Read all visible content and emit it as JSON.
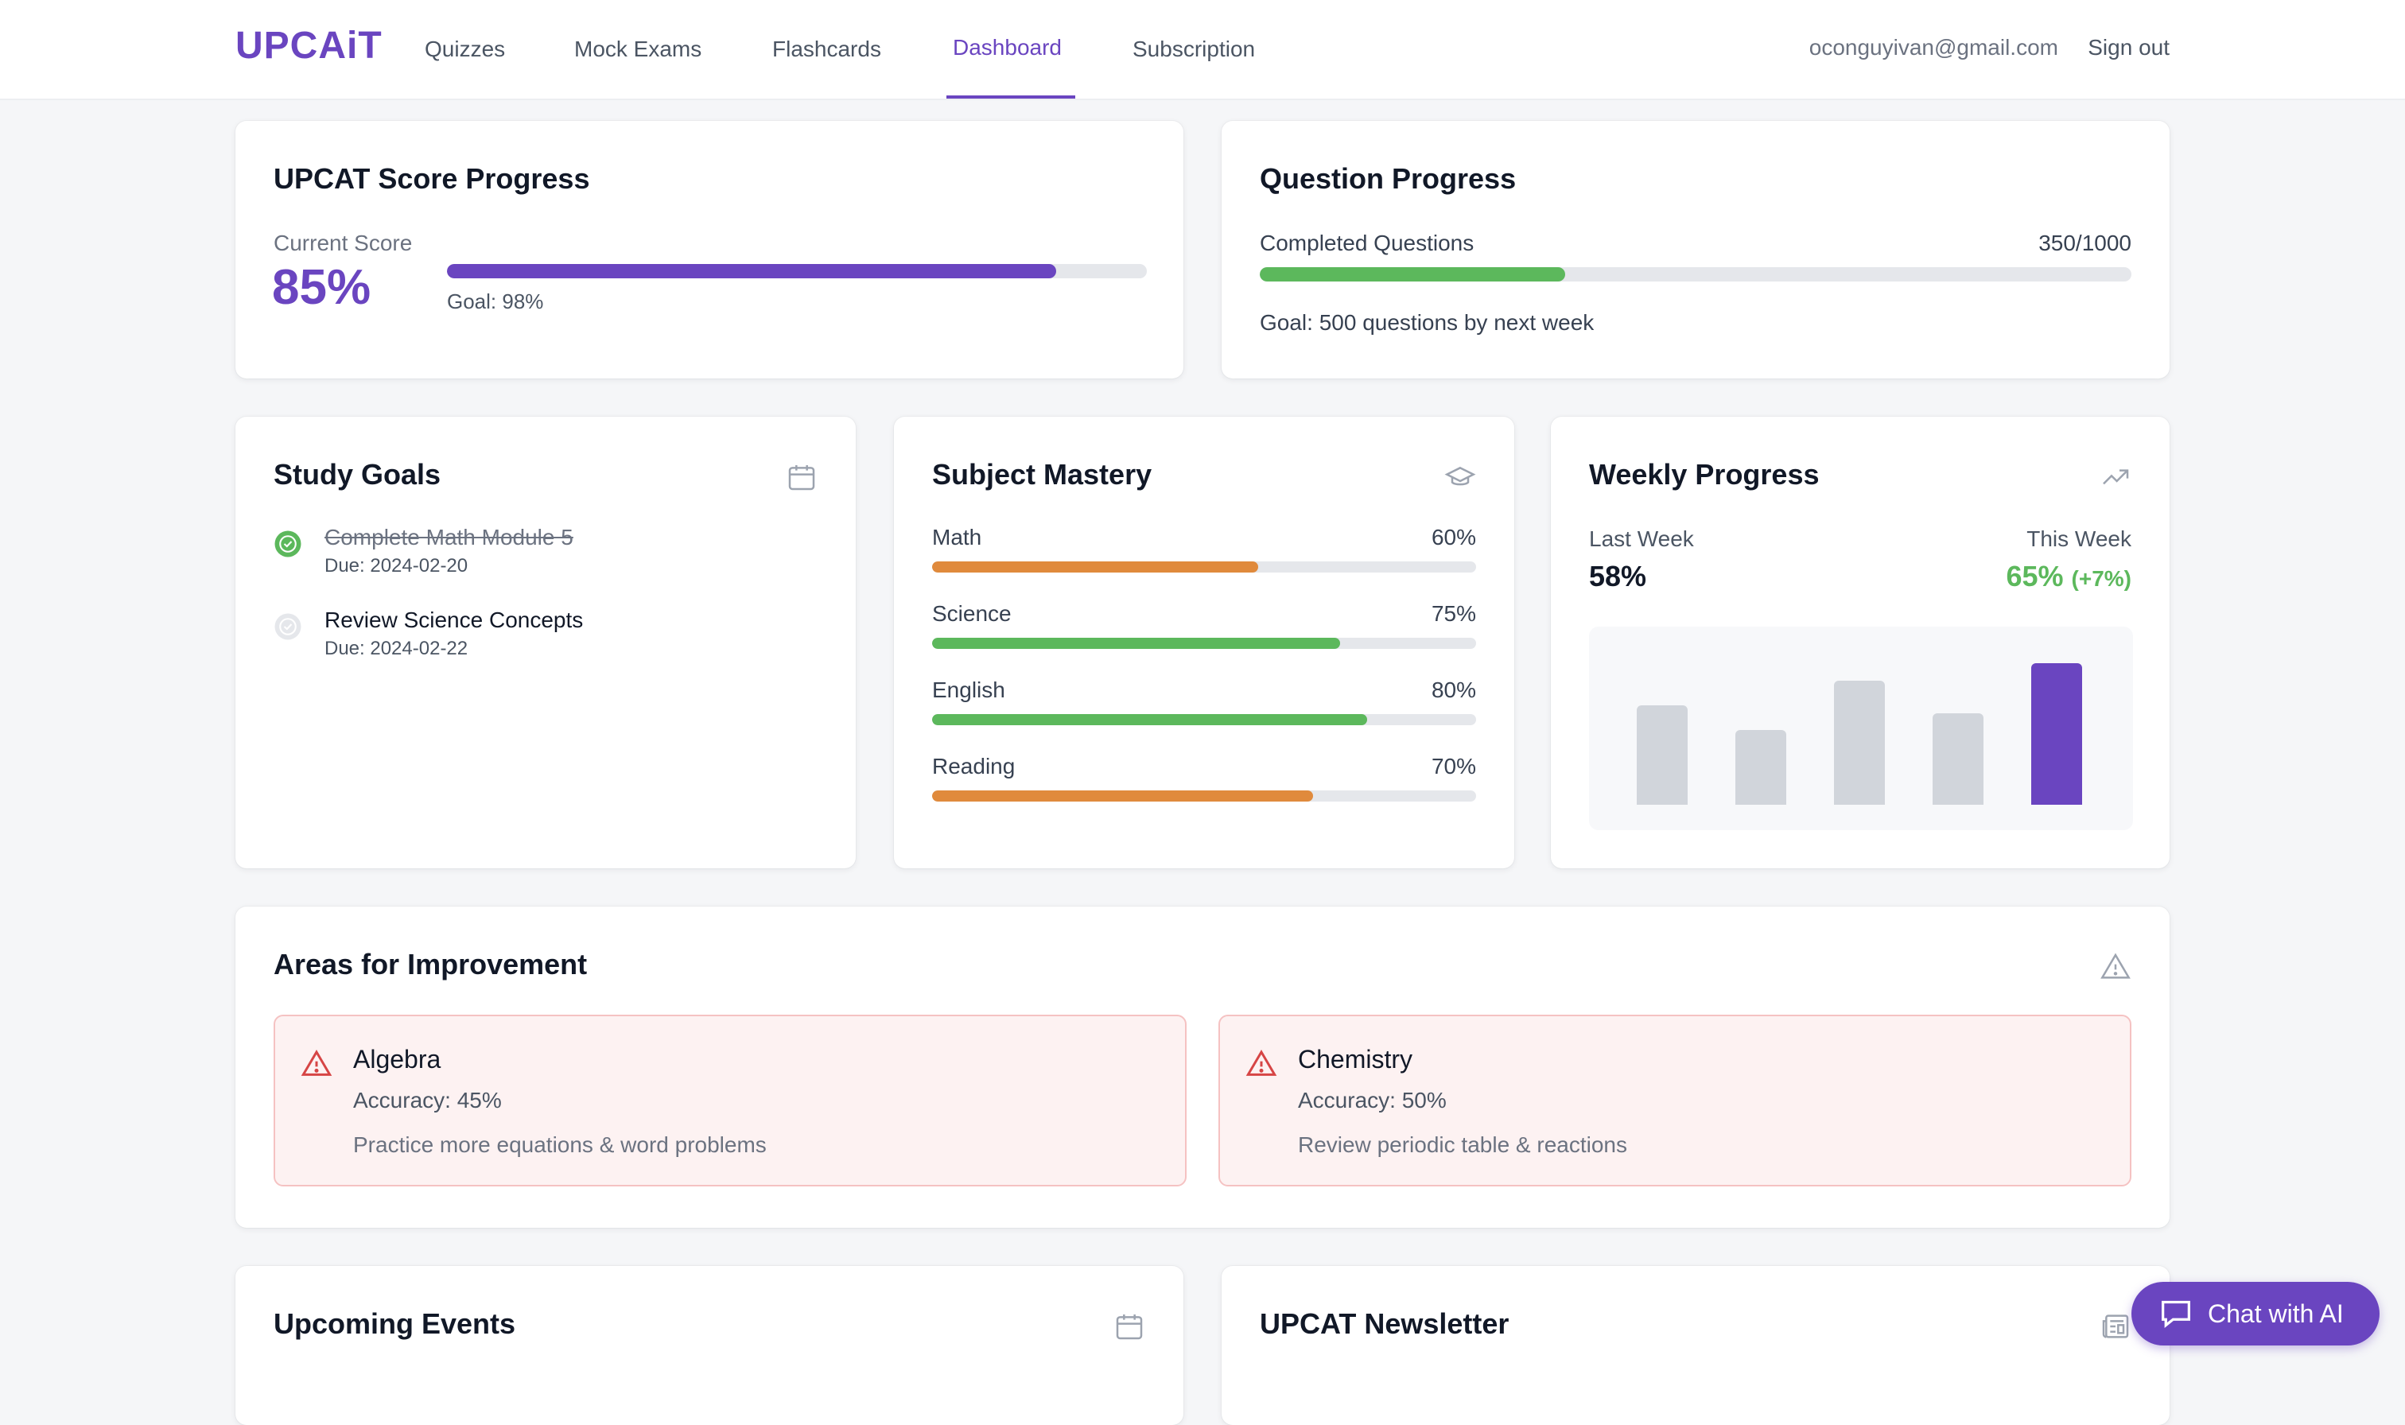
{
  "nav": {
    "brand": "UPCAiT",
    "links": [
      "Quizzes",
      "Mock Exams",
      "Flashcards",
      "Dashboard",
      "Subscription"
    ],
    "active": "Dashboard",
    "email": "oconguyivan@gmail.com",
    "sign_out": "Sign out"
  },
  "score_progress": {
    "title": "UPCAT Score Progress",
    "current_label": "Current Score",
    "current_value": "85%",
    "progress_fraction": 0.87,
    "goal": "Goal: 98%"
  },
  "question_progress": {
    "title": "Question Progress",
    "label": "Completed Questions",
    "count": "350/1000",
    "progress_fraction": 0.35,
    "goal": "Goal: 500 questions by next week"
  },
  "study_goals": {
    "title": "Study Goals",
    "icon": "calendar-icon",
    "items": [
      {
        "text": "Complete Math Module 5",
        "due": "Due: 2024-02-20",
        "done": true
      },
      {
        "text": "Review Science Concepts",
        "due": "Due: 2024-02-22",
        "done": false
      }
    ]
  },
  "subject_mastery": {
    "title": "Subject Mastery",
    "icon": "graduation-cap-icon",
    "subjects": [
      {
        "name": "Math",
        "percent": "60%",
        "value": 60,
        "color": "#e08a3c"
      },
      {
        "name": "Science",
        "percent": "75%",
        "value": 75,
        "color": "#5cb85c"
      },
      {
        "name": "English",
        "percent": "80%",
        "value": 80,
        "color": "#5cb85c"
      },
      {
        "name": "Reading",
        "percent": "70%",
        "value": 70,
        "color": "#e08a3c"
      }
    ]
  },
  "weekly_progress": {
    "title": "Weekly Progress",
    "icon": "trending-up-icon",
    "last_week_label": "Last Week",
    "last_week_value": "58%",
    "this_week_label": "This Week",
    "this_week_value": "65%",
    "this_week_delta": "(+7%)",
    "bar_levels": [
      0.52,
      0.39,
      0.65,
      0.48,
      0.74
    ],
    "highlight_index": 4
  },
  "areas": {
    "title": "Areas for Improvement",
    "icon": "warning-icon",
    "items": [
      {
        "subject": "Algebra",
        "accuracy": "Accuracy: 45%",
        "tip": "Practice more equations & word problems"
      },
      {
        "subject": "Chemistry",
        "accuracy": "Accuracy: 50%",
        "tip": "Review periodic table & reactions"
      }
    ]
  },
  "upcoming_events": {
    "title": "Upcoming Events",
    "icon": "calendar-icon"
  },
  "newsletter": {
    "title": "UPCAT Newsletter",
    "icon": "newspaper-icon"
  },
  "chat": {
    "label": "Chat with AI",
    "icon": "chat-bubble-icon"
  },
  "colors": {
    "accent": "#6a45c0",
    "success": "#5cb85c",
    "warning": "#e08a3c",
    "danger": "#d64545"
  }
}
